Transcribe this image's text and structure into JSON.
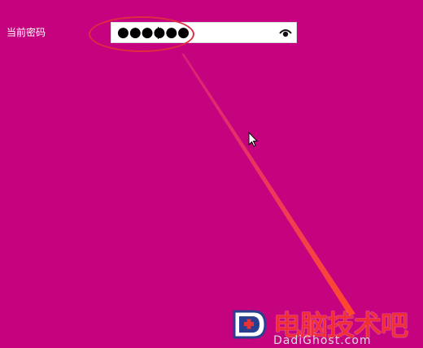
{
  "password_section": {
    "label": "当前密码",
    "masked_value": "●●●●●●",
    "reveal_icon": "eye-icon"
  },
  "watermark": {
    "title": "电脑技术吧",
    "subtitle": "DadiGhost.com"
  },
  "colors": {
    "background": "#c5037f",
    "annotation_red": "#e12b42",
    "watermark_red": "#f02e38"
  }
}
